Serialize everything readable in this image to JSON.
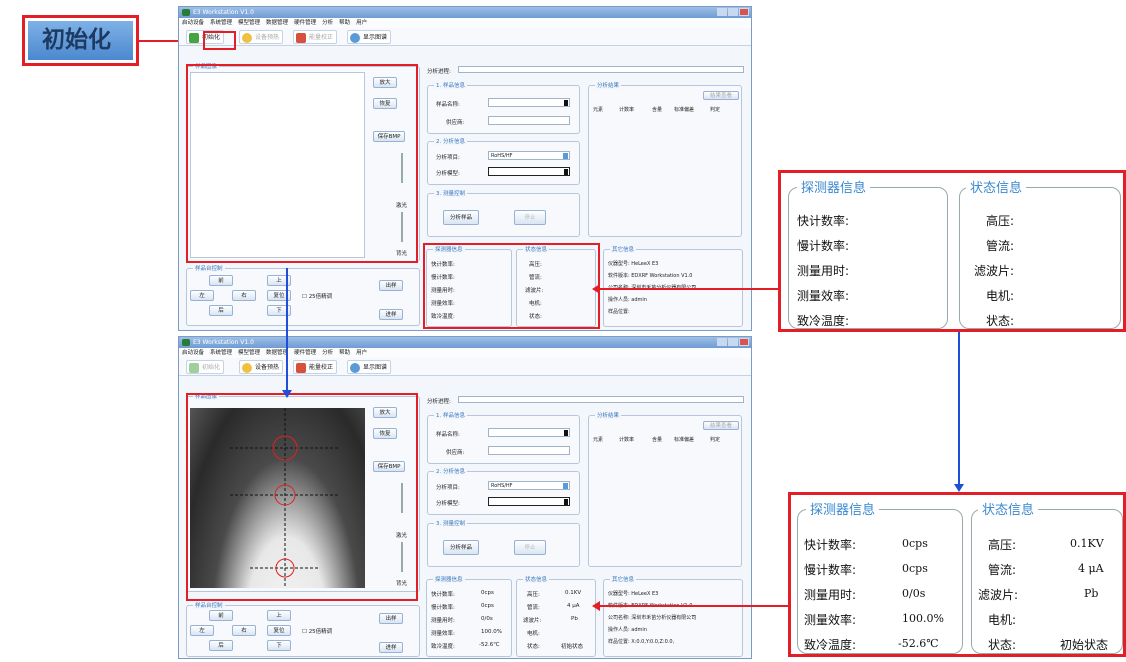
{
  "label_init": "初始化",
  "window": {
    "title": "E3 Workstation V1.0",
    "menu": [
      "启动设备",
      "系统管理",
      "模型管理",
      "数据管理",
      "硬件管理",
      "分析",
      "帮助",
      "用户"
    ],
    "toolbar": {
      "init": "初始化",
      "preset": "设备预热",
      "calib": "能量校正",
      "show": "显示图谱"
    },
    "camera_group": "样品图像",
    "btn_zoom_in": "放大",
    "btn_restore": "恢复",
    "btn_save_bmp": "保存BMP",
    "light1": "激光",
    "light2": "背光",
    "motion_group": "样品台控制",
    "move": {
      "front": "前",
      "up": "上",
      "left": "左",
      "right": "右",
      "reset": "复位",
      "back": "后",
      "down": "下",
      "fine": "25倍精调",
      "out": "出样",
      "in": "进样"
    },
    "progress_label": "分析进程:",
    "sample_group": "1. 样品信息",
    "sample_name": "样品名称:",
    "supplier": "供应商:",
    "analysis_group": "2. 分析信息",
    "analysis_item": "分析项目:",
    "analysis_item_value": "RoHS/HF",
    "analysis_model": "分析模型:",
    "measure_group": "3. 测量控制",
    "btn_analyze": "分析样品",
    "btn_stop": "停止",
    "result_group": "分析结果",
    "result_btn": "结果查看",
    "result_cols": [
      "元素",
      "计数率",
      "含量",
      "标准偏差",
      "判定"
    ],
    "det_group": "探测器信息",
    "det_labels": [
      "快计数率:",
      "慢计数率:",
      "测量用时:",
      "测量效率:",
      "致冷温度:"
    ],
    "det_values2": [
      "0cps",
      "0cps",
      "0/0s",
      "100.0%",
      "-52.6℃"
    ],
    "status_group": "状态信息",
    "status_labels": [
      "高压:",
      "管流:",
      "滤波片:",
      "电机:",
      "状态:"
    ],
    "status_values2": [
      "0.1KV",
      "4 μA",
      "Pb",
      "",
      "初始状态"
    ],
    "other_group": "其它信息",
    "other_lines1": [
      "仪器型号: HeLeeX E3",
      "软件版本: EDXRF Workstation V1.0",
      "公司名称: 深圳市禾苗分析仪器有限公司",
      "操作人员: admin",
      "样品位置:"
    ],
    "other_lines2": [
      "仪器型号: HeLeeX E3",
      "软件版本: EDXRF Workstation V1.0",
      "公司名称: 深圳市禾苗分析仪器有限公司",
      "操作人员: admin",
      "样品位置: X:0.0,Y:0.0,Z:0.0,"
    ]
  },
  "callout_top": {
    "det_title": "探测器信息",
    "det_labels": [
      "快计数率:",
      "慢计数率:",
      "测量用时:",
      "测量效率:",
      "致冷温度:"
    ],
    "status_title": "状态信息",
    "status_labels": [
      "高压:",
      "管流:",
      "滤波片:",
      "电机:",
      "状态:"
    ]
  },
  "callout_bottom": {
    "det_title": "探测器信息",
    "det_labels": [
      "快计数率:",
      "慢计数率:",
      "测量用时:",
      "测量效率:",
      "致冷温度:"
    ],
    "det_values": [
      "0cps",
      "0cps",
      "0/0s",
      "100.0%",
      "-52.6℃"
    ],
    "status_title": "状态信息",
    "status_labels": [
      "高压:",
      "管流:",
      "滤波片:",
      "电机:",
      "状态:"
    ],
    "status_values": [
      "0.1KV",
      "4 μA",
      "Pb",
      "",
      "初始状态"
    ]
  },
  "colors": {
    "red": "#e41e26",
    "blue": "#1f4ed8",
    "accent": "#3a88d0"
  }
}
